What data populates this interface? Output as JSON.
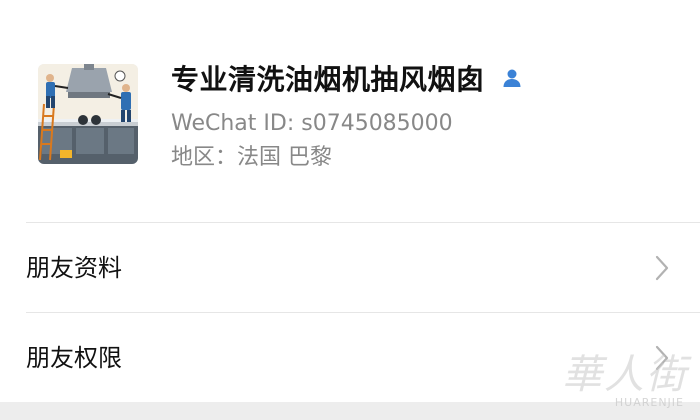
{
  "profile": {
    "name": "专业清洗油烟机抽风烟囱",
    "wechat_id": "WeChat ID: s0745085000",
    "region": "地区：法国 巴黎",
    "avatar_icon": "kitchen-cleaning-avatar",
    "gender_icon": "male-user-icon",
    "gender_icon_color": "#3b82d6"
  },
  "menu": {
    "items": [
      {
        "label": "朋友资料",
        "icon": "chevron-right-icon"
      },
      {
        "label": "朋友权限",
        "icon": "chevron-right-icon"
      }
    ]
  },
  "watermark": {
    "text_zh": "華人街",
    "text_en": "HUARENJIE"
  },
  "colors": {
    "background": "#ffffff",
    "primary_text": "#111111",
    "secondary_text": "#888888",
    "divider": "#e6e6e6",
    "chevron": "#b2b2b2"
  }
}
